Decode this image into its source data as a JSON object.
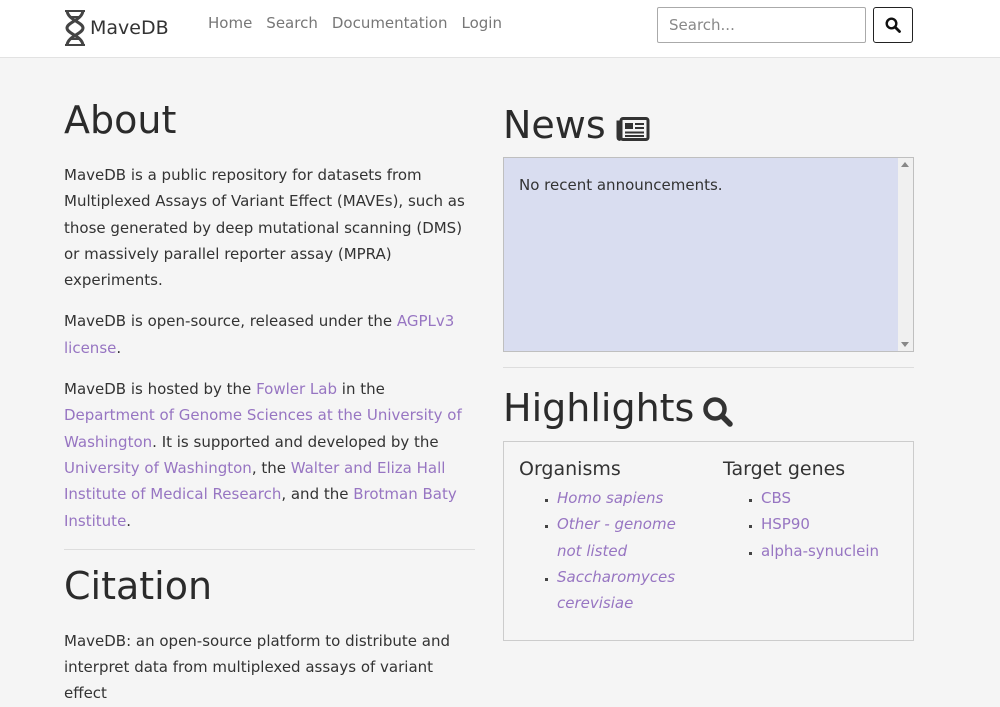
{
  "navbar": {
    "brand": "MaveDB",
    "links": [
      "Home",
      "Search",
      "Documentation",
      "Login"
    ],
    "search_placeholder": "Search..."
  },
  "about": {
    "title": "About",
    "p1": "MaveDB is a public repository for datasets from Multiplexed Assays of Variant Effect (MAVEs), such as those generated by deep mutational scanning (DMS) or massively parallel reporter assay (MPRA) experiments.",
    "p2_text": "MaveDB is open-source, released under the ",
    "p2_link": "AGPLv3 license",
    "p2_end": ".",
    "p3_a": "MaveDB is hosted by the ",
    "p3_link1": "Fowler Lab",
    "p3_b": " in the ",
    "p3_link2": "Department of Genome Sciences at the University of Washington",
    "p3_c": ". It is supported and developed by the ",
    "p3_link3": "University of Washington",
    "p3_d": ", the ",
    "p3_link4": "Walter and Eliza Hall Institute of Medical Research",
    "p3_e": ", and the ",
    "p3_link5": "Brotman Baty Institute",
    "p3_f": "."
  },
  "citation": {
    "title": "Citation",
    "text": "MaveDB: an open-source platform to distribute and interpret data from multiplexed assays of variant effect"
  },
  "news": {
    "title": "News",
    "message": "No recent announcements."
  },
  "highlights": {
    "title": "Highlights",
    "organisms_title": "Organisms",
    "organisms": [
      "Homo sapiens",
      "Other - genome not listed",
      "Saccharomyces cerevisiae"
    ],
    "genes_title": "Target genes",
    "genes": [
      "CBS",
      "HSP90",
      "alpha-synuclein"
    ]
  }
}
